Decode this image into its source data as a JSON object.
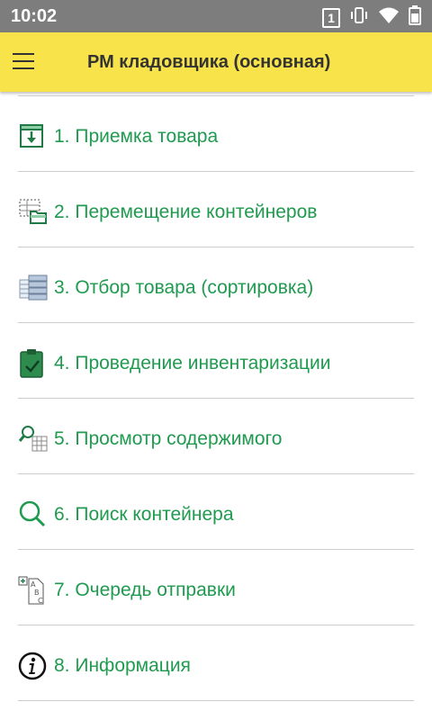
{
  "status_bar": {
    "time": "10:02",
    "sim": "1"
  },
  "app_bar": {
    "title": "РМ кладовщика (основная)"
  },
  "menu": {
    "items": [
      {
        "label": "1. Приемка товара",
        "icon": "receive-goods-icon"
      },
      {
        "label": "2. Перемещение контейнеров",
        "icon": "move-containers-icon"
      },
      {
        "label": "3. Отбор товара (сортировка)",
        "icon": "picking-icon"
      },
      {
        "label": "4. Проведение инвентаризации",
        "icon": "inventory-icon"
      },
      {
        "label": "5. Просмотр содержимого",
        "icon": "view-contents-icon"
      },
      {
        "label": "6. Поиск контейнера",
        "icon": "search-icon"
      },
      {
        "label": "7. Очередь отправки",
        "icon": "send-queue-icon"
      },
      {
        "label": "8. Информация",
        "icon": "info-icon"
      }
    ]
  },
  "colors": {
    "status_bar": "#7d7d7d",
    "app_bar": "#f8e44a",
    "item_text": "#1f9a4f",
    "divider": "#cccccc"
  }
}
